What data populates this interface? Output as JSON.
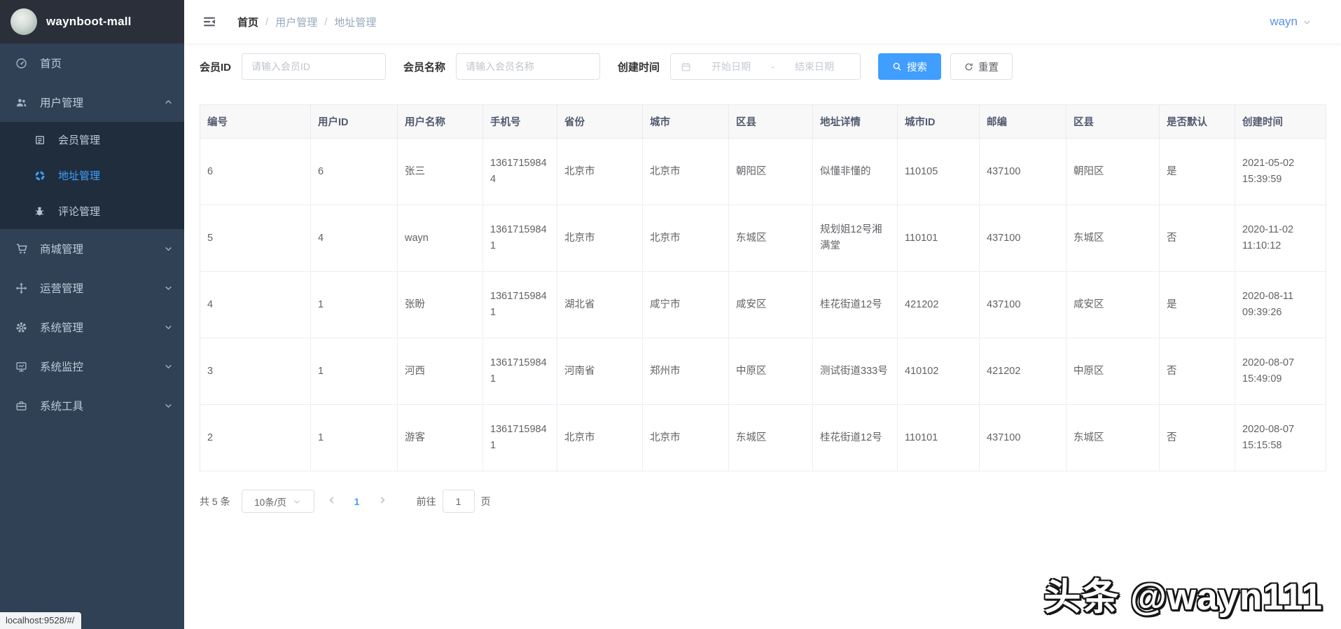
{
  "app": {
    "title": "waynboot-mall",
    "url_bar": "localhost:9528/#/",
    "watermark": "头条 @wayn111"
  },
  "colors": {
    "accent": "#409eff",
    "sidebar_bg": "#304156",
    "submenu_bg": "#1f2d3d",
    "logo_bg": "#2b2f3a",
    "username_blue": "#5a8fee"
  },
  "sidebar": {
    "items": [
      {
        "key": "home",
        "label": "首页",
        "icon": "dashboard-icon"
      },
      {
        "key": "user-mgmt",
        "label": "用户管理",
        "icon": "users-icon",
        "arrow": "up",
        "expanded": true,
        "children": [
          {
            "key": "member-mgmt",
            "label": "会员管理",
            "icon": "document-icon"
          },
          {
            "key": "address-mgmt",
            "label": "地址管理",
            "icon": "component-icon",
            "active": true
          },
          {
            "key": "comment-mgmt",
            "label": "评论管理",
            "icon": "bug-icon"
          }
        ]
      },
      {
        "key": "mall-mgmt",
        "label": "商城管理",
        "icon": "shopping-cart-icon",
        "arrow": "down"
      },
      {
        "key": "operations-mgmt",
        "label": "运营管理",
        "icon": "move-icon",
        "arrow": "down"
      },
      {
        "key": "system-mgmt",
        "label": "系统管理",
        "icon": "gear-icon",
        "arrow": "down"
      },
      {
        "key": "system-monitor",
        "label": "系统监控",
        "icon": "monitor-icon",
        "arrow": "down"
      },
      {
        "key": "system-tools",
        "label": "系统工具",
        "icon": "toolbox-icon",
        "arrow": "down"
      }
    ]
  },
  "header": {
    "hamburger_icon": "hamburger-icon",
    "breadcrumb": {
      "home": "首页",
      "separator": "/",
      "level1": "用户管理",
      "level2": "地址管理"
    },
    "user": "wayn",
    "user_chevron_icon": "chevron-down-icon"
  },
  "filters": {
    "member_id_label": "会员ID",
    "member_id_placeholder": "请输入会员ID",
    "member_name_label": "会员名称",
    "member_name_placeholder": "请输入会员名称",
    "created_label": "创建时间",
    "calendar_icon": "calendar-icon",
    "start_placeholder": "开始日期",
    "range_separator": "-",
    "end_placeholder": "结束日期",
    "search_label": "搜索",
    "search_icon": "search-icon",
    "reset_label": "重置",
    "reset_icon": "refresh-icon"
  },
  "table": {
    "columns": [
      "编号",
      "用户ID",
      "用户名称",
      "手机号",
      "省份",
      "城市",
      "区县",
      "地址详情",
      "城市ID",
      "邮编",
      "区县",
      "是否默认",
      "创建时间"
    ],
    "rows": [
      [
        "6",
        "6",
        "张三",
        "13617159844",
        "北京市",
        "北京市",
        "朝阳区",
        "似懂非懂的",
        "110105",
        "437100",
        "朝阳区",
        "是",
        "2021-05-02 15:39:59"
      ],
      [
        "5",
        "4",
        "wayn",
        "13617159841",
        "北京市",
        "北京市",
        "东城区",
        "规划姐12号湘满堂",
        "110101",
        "437100",
        "东城区",
        "否",
        "2020-11-02 11:10:12"
      ],
      [
        "4",
        "1",
        "张盼",
        "13617159841",
        "湖北省",
        "咸宁市",
        "咸安区",
        "桂花街道12号",
        "421202",
        "437100",
        "咸安区",
        "是",
        "2020-08-11 09:39:26"
      ],
      [
        "3",
        "1",
        "河西",
        "13617159841",
        "河南省",
        "郑州市",
        "中原区",
        "测试街道333号",
        "410102",
        "421202",
        "中原区",
        "否",
        "2020-08-07 15:49:09"
      ],
      [
        "2",
        "1",
        "游客",
        "13617159841",
        "北京市",
        "北京市",
        "东城区",
        "桂花街道12号",
        "110101",
        "437100",
        "东城区",
        "否",
        "2020-08-07 15:15:58"
      ]
    ]
  },
  "pagination": {
    "total_label": "共 5 条",
    "page_size_value": "10条/页",
    "prev_icon": "chevron-left-icon",
    "current_page": "1",
    "next_icon": "chevron-right-icon",
    "goto_label": "前往",
    "goto_value": "1",
    "goto_suffix": "页"
  }
}
